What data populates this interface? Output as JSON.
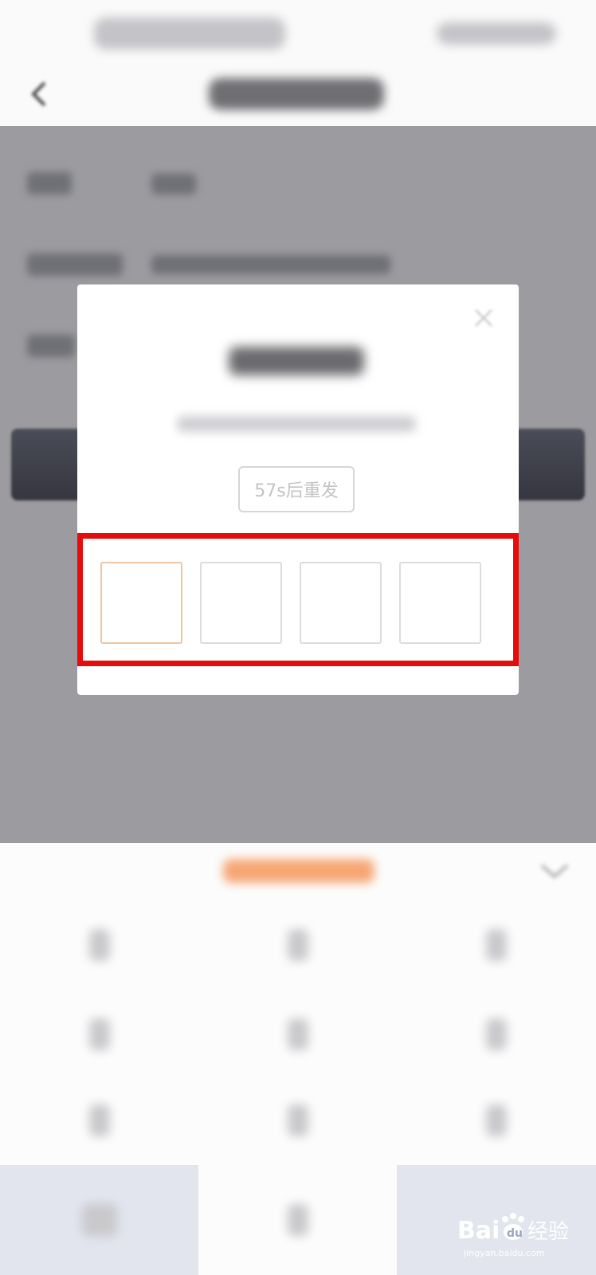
{
  "modal": {
    "resend_label": "57s后重发",
    "code_boxes": [
      "",
      "",
      "",
      ""
    ]
  },
  "watermark": {
    "brand_left": "Bai",
    "brand_right": "经验",
    "url": "jingyan.baidu.com"
  },
  "colors": {
    "highlight": "#e60c0c",
    "active_box": "#eec6a5",
    "keyboard_accent": "#f6a673"
  },
  "icons": [
    "back-arrow-icon",
    "close-icon",
    "collapse-keyboard-icon",
    "baidu-paw-icon"
  ]
}
